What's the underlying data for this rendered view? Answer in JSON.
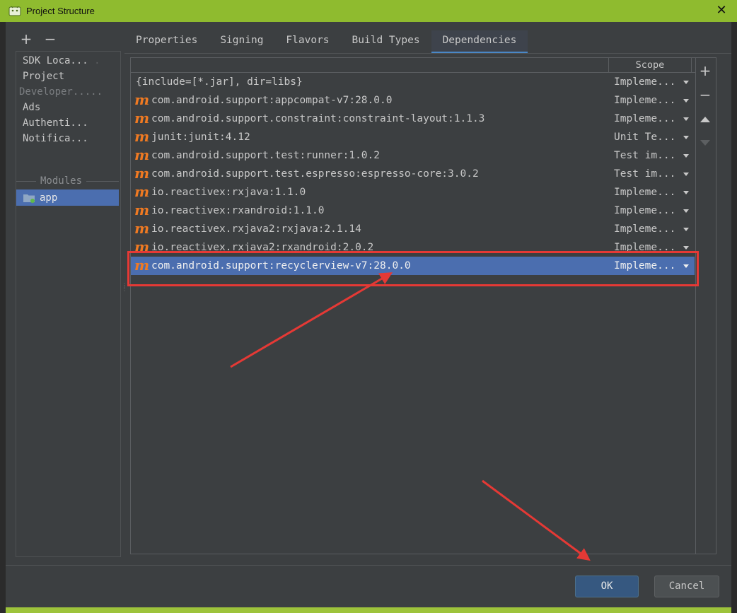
{
  "window": {
    "title": "Project Structure",
    "close_glyph": "✕"
  },
  "sidebar_tools": {
    "add": "+",
    "remove": "−"
  },
  "sidebar": {
    "items": [
      {
        "label": "SDK Loca...",
        "dots": " ."
      },
      {
        "label": "Project",
        "dots": ""
      },
      {
        "label": "Developer.....",
        "dots": ""
      },
      {
        "label": "Ads",
        "dots": ""
      },
      {
        "label": "Authenti...",
        "dots": ""
      },
      {
        "label": "Notifica...",
        "dots": ""
      }
    ],
    "modules_label": "Modules",
    "module_app": "app"
  },
  "tabs": [
    {
      "label": "Properties"
    },
    {
      "label": "Signing"
    },
    {
      "label": "Flavors"
    },
    {
      "label": "Build Types"
    },
    {
      "label": "Dependencies"
    }
  ],
  "active_tab": "Dependencies",
  "table": {
    "scope_header": "Scope",
    "icon_glyph": "m",
    "rows": [
      {
        "name": "{include=[*.jar], dir=libs}",
        "scope": "Impleme...",
        "icon": "none"
      },
      {
        "name": "com.android.support:appcompat-v7:28.0.0",
        "scope": "Impleme...",
        "icon": "maven-icon"
      },
      {
        "name": "com.android.support.constraint:constraint-layout:1.1.3",
        "scope": "Impleme...",
        "icon": "maven-icon"
      },
      {
        "name": "junit:junit:4.12",
        "scope": "Unit Te...",
        "icon": "maven-icon"
      },
      {
        "name": "com.android.support.test:runner:1.0.2",
        "scope": "Test im...",
        "icon": "maven-icon"
      },
      {
        "name": "com.android.support.test.espresso:espresso-core:3.0.2",
        "scope": "Test im...",
        "icon": "maven-icon"
      },
      {
        "name": "io.reactivex:rxjava:1.1.0",
        "scope": "Impleme...",
        "icon": "maven-icon"
      },
      {
        "name": "io.reactivex:rxandroid:1.1.0",
        "scope": "Impleme...",
        "icon": "maven-icon"
      },
      {
        "name": "io.reactivex.rxjava2:rxjava:2.1.14",
        "scope": "Impleme...",
        "icon": "maven-icon"
      },
      {
        "name": "io.reactivex.rxjava2:rxandroid:2.0.2",
        "scope": "Impleme...",
        "icon": "maven-icon"
      },
      {
        "name": "com.android.support:recyclerview-v7:28.0.0",
        "scope": "Impleme...",
        "icon": "maven-icon",
        "selected": true
      }
    ]
  },
  "right_toolbar": {
    "add": "+",
    "remove": "−"
  },
  "buttons": {
    "ok": "OK",
    "cancel": "Cancel"
  },
  "colors": {
    "titlebar": "#8fbb2f",
    "selection": "#4b6eaf",
    "maven_icon": "#f07a22",
    "annotation_red": "#e53935"
  }
}
